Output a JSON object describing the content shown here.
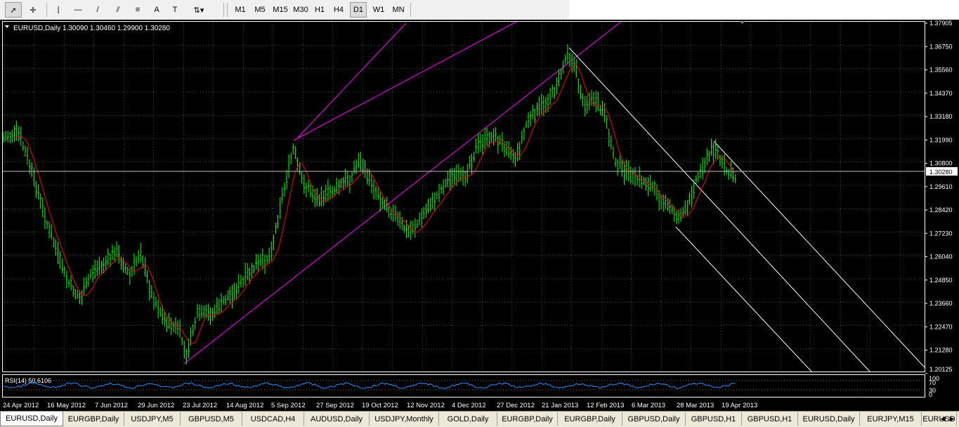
{
  "toolbar": {
    "tools": [
      {
        "name": "cursor-tool-icon",
        "glyph": "➚"
      },
      {
        "name": "crosshair-tool-icon",
        "glyph": "✛"
      },
      {
        "name": "vertical-line-tool-icon",
        "glyph": "|"
      },
      {
        "name": "horizontal-line-tool-icon",
        "glyph": "—"
      },
      {
        "name": "trendline-tool-icon",
        "glyph": "/"
      },
      {
        "name": "equidistant-channel-tool-icon",
        "glyph": "⫽"
      },
      {
        "name": "fibonacci-tool-icon",
        "glyph": "≡"
      },
      {
        "name": "text-tool-icon",
        "glyph": "A"
      },
      {
        "name": "text-label-tool-icon",
        "glyph": "T"
      },
      {
        "name": "arrows-tool-icon",
        "glyph": "⇅▾"
      }
    ],
    "timeframes": [
      "M1",
      "M5",
      "M15",
      "M30",
      "H1",
      "H4",
      "D1",
      "W1",
      "MN"
    ],
    "active_timeframe": "D1"
  },
  "chart": {
    "header": "EURUSD,Daily  1.30090 1.30460 1.29900 1.30280",
    "current_price": "1.30280",
    "price_labels": [
      "1.37905",
      "1.36750",
      "1.35560",
      "1.34370",
      "1.33180",
      "1.31990",
      "1.30800",
      "1.29610",
      "1.28420",
      "1.27230",
      "1.26040",
      "1.24850",
      "1.23660",
      "1.22470",
      "1.21280",
      "1.20125"
    ],
    "date_labels": [
      "24 Apr 2012",
      "16 May 2012",
      "7 Jun 2012",
      "29 Jun 2012",
      "23 Jul 2012",
      "14 Aug 2012",
      "5 Sep 2012",
      "27 Sep 2012",
      "19 Oct 2012",
      "12 Nov 2012",
      "4 Dec 2012",
      "27 Dec 2012",
      "21 Jan 2013",
      "12 Feb 2013",
      "6 Mar 2013",
      "28 Mar 2013",
      "19 Apr 2013"
    ],
    "rsi_header": "RSI(14) 50.6106",
    "rsi_levels": [
      "100",
      "70",
      "30",
      "0"
    ],
    "colors": {
      "bars": "#00ff00",
      "ma": "#ff0000",
      "channel": "#ff00ff",
      "down_channel": "#ffffff",
      "grid": "#5a6e6e",
      "rsi": "#1e90ff"
    }
  },
  "tabs": [
    "EURUSD,Daily",
    "EURGBP,Daily",
    "USDJPY,M5",
    "GBPUSD,M5",
    "USDCAD,H4",
    "AUDUSD,Daily",
    "USDJPY,Monthly",
    "GOLD,Daily",
    "EURGBP,Daily",
    "EURGBP,Daily",
    "GBPUSD,Daily",
    "GBPUSD,H1",
    "GBPUSD,H1",
    "EURUSD,Daily",
    "EURJPY,M15",
    "EURUSD"
  ],
  "active_tab": "EURUSD,Daily",
  "tab_scroll": {
    "left": "◀",
    "right": "▶"
  }
}
